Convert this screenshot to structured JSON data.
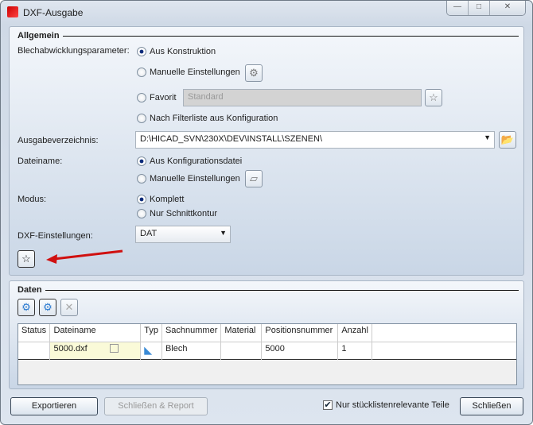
{
  "window": {
    "title": "DXF-Ausgabe",
    "minimize": "—",
    "maximize": "□",
    "close": "✕"
  },
  "allgemein": {
    "legend": "Allgemein",
    "blech_label": "Blechabwicklungsparameter:",
    "blech_options": [
      "Aus Konstruktion",
      "Manuelle Einstellungen",
      "Favorit",
      "Nach Filterliste aus Konfiguration"
    ],
    "favorit_value": "Standard",
    "ausgabe_label": "Ausgabeverzeichnis:",
    "ausgabe_value": "D:\\HICAD_SVN\\230X\\DEV\\INSTALL\\SZENEN\\",
    "dateiname_label": "Dateiname:",
    "dateiname_options": [
      "Aus Konfigurationsdatei",
      "Manuelle Einstellungen"
    ],
    "modus_label": "Modus:",
    "modus_options": [
      "Komplett",
      "Nur Schnittkontur"
    ],
    "dxf_label": "DXF-Einstellungen:",
    "dxf_value": "DAT"
  },
  "daten": {
    "legend": "Daten",
    "columns": [
      "Status",
      "Dateiname",
      "Typ",
      "Sachnummer",
      "Material",
      "Positionsnummer",
      "Anzahl"
    ],
    "rows": [
      {
        "status": "",
        "dateiname": "5000.dxf",
        "typ": "",
        "sachnummer": "Blech",
        "material": "",
        "positionsnummer": "5000",
        "anzahl": "1"
      }
    ]
  },
  "footer": {
    "export": "Exportieren",
    "close_report": "Schließen & Report",
    "checkbox": "Nur stücklistenrelevante Teile",
    "close": "Schließen"
  },
  "colors": {
    "arrow": "#d01010"
  }
}
